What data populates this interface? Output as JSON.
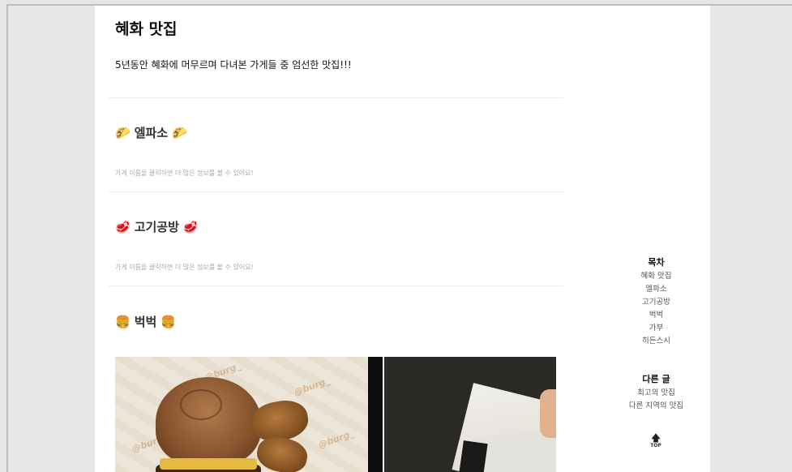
{
  "blog": {
    "title": "혜화 맛집",
    "subtitle": "5년동안 혜화에 머무르며 다녀본 가게들 중 엄선한 맛집!!!"
  },
  "sections": [
    {
      "emoji": "🌮",
      "name": "엘파소",
      "hint": "가게 이름을 클릭하면 더 많은 정보를 볼 수 있어요!"
    },
    {
      "emoji": "🥩",
      "name": "고기공방",
      "hint": "가게 이름을 클릭하면 더 많은 정보를 볼 수 있어요!"
    },
    {
      "emoji": "🍔",
      "name": "벅벅"
    }
  ],
  "photos": {
    "stamp_text": "@burg_"
  },
  "toc": {
    "title": "목차",
    "items": [
      "혜화 맛집",
      "엘파소",
      "고기공방",
      "벅벅",
      "가부",
      "히든스시"
    ]
  },
  "other_posts": {
    "title": "다른 글",
    "items": [
      "최고의 맛집",
      "다른 지역의 맛집"
    ]
  },
  "top_button": {
    "label": "TOP",
    "icon": "up-arrow-icon"
  }
}
